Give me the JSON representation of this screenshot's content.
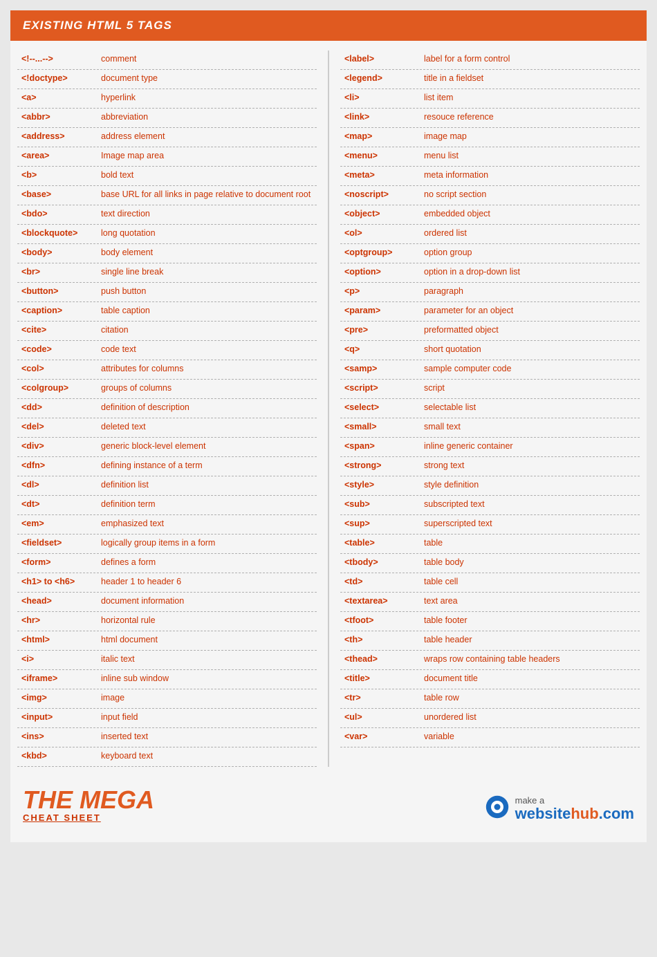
{
  "header": {
    "title": "EXISTING HTML 5 TAGS"
  },
  "footer": {
    "left_line1": "THE MEGA",
    "left_line2": "CHEAT SHEET",
    "right_line1": "make a",
    "right_line2": "websitehub.com"
  },
  "left_column": [
    {
      "tag": "&lt;!--...--&gt;",
      "desc": "comment"
    },
    {
      "tag": "&lt;!doctype&gt;",
      "desc": "document type"
    },
    {
      "tag": "&lt;a&gt;",
      "desc": "hyperlink"
    },
    {
      "tag": "&lt;abbr&gt;",
      "desc": "abbreviation"
    },
    {
      "tag": "&lt;address&gt;",
      "desc": "address element"
    },
    {
      "tag": "&lt;area&gt;",
      "desc": "Image map area"
    },
    {
      "tag": "&lt;b&gt;",
      "desc": "bold text"
    },
    {
      "tag": "&lt;base&gt;",
      "desc": "base URL for all links in page relative to document root"
    },
    {
      "tag": "&lt;bdo&gt;",
      "desc": "text direction"
    },
    {
      "tag": "&lt;blockquote&gt;",
      "desc": "long quotation"
    },
    {
      "tag": "&lt;body&gt;",
      "desc": "body element"
    },
    {
      "tag": "&lt;br&gt;",
      "desc": "single line break"
    },
    {
      "tag": "&lt;button&gt;",
      "desc": "push button"
    },
    {
      "tag": "&lt;caption&gt;",
      "desc": "table caption"
    },
    {
      "tag": "&lt;cite&gt;",
      "desc": "citation"
    },
    {
      "tag": "&lt;code&gt;",
      "desc": "code text"
    },
    {
      "tag": "&lt;col&gt;",
      "desc": "attributes for columns"
    },
    {
      "tag": "&lt;colgroup&gt;",
      "desc": "groups of columns"
    },
    {
      "tag": "&lt;dd&gt;",
      "desc": "definition of description"
    },
    {
      "tag": "&lt;del&gt;",
      "desc": "deleted text"
    },
    {
      "tag": "&lt;div&gt;",
      "desc": "generic block-level element"
    },
    {
      "tag": "&lt;dfn&gt;",
      "desc": "defining instance of a term"
    },
    {
      "tag": "&lt;dl&gt;",
      "desc": "definition list"
    },
    {
      "tag": "&lt;dt&gt;",
      "desc": "definition term"
    },
    {
      "tag": "&lt;em&gt;",
      "desc": "emphasized text"
    },
    {
      "tag": "&lt;fieldset&gt;",
      "desc": "logically group items in a form"
    },
    {
      "tag": "&lt;form&gt;",
      "desc": "defines a form"
    },
    {
      "tag": "&lt;h1&gt; to &lt;h6&gt;",
      "desc": "header 1 to header 6"
    },
    {
      "tag": "&lt;head&gt;",
      "desc": "document information"
    },
    {
      "tag": "&lt;hr&gt;",
      "desc": "horizontal rule"
    },
    {
      "tag": "&lt;html&gt;",
      "desc": "html document"
    },
    {
      "tag": "&lt;i&gt;",
      "desc": "italic text"
    },
    {
      "tag": "&lt;iframe&gt;",
      "desc": "inline sub window"
    },
    {
      "tag": "&lt;img&gt;",
      "desc": "image"
    },
    {
      "tag": "&lt;input&gt;",
      "desc": "input field"
    },
    {
      "tag": "&lt;ins&gt;",
      "desc": "inserted text"
    },
    {
      "tag": "&lt;kbd&gt;",
      "desc": "keyboard text"
    }
  ],
  "right_column": [
    {
      "tag": "&lt;label&gt;",
      "desc": "label for a form control"
    },
    {
      "tag": "&lt;legend&gt;",
      "desc": "title in a fieldset"
    },
    {
      "tag": "&lt;li&gt;",
      "desc": "list item"
    },
    {
      "tag": "&lt;link&gt;",
      "desc": "resouce reference"
    },
    {
      "tag": "&lt;map&gt;",
      "desc": "image map"
    },
    {
      "tag": "&lt;menu&gt;",
      "desc": "menu list"
    },
    {
      "tag": "&lt;meta&gt;",
      "desc": "meta information"
    },
    {
      "tag": "&lt;noscript&gt;",
      "desc": "no script section"
    },
    {
      "tag": "&lt;object&gt;",
      "desc": "embedded object"
    },
    {
      "tag": "&lt;ol&gt;",
      "desc": "ordered list"
    },
    {
      "tag": "&lt;optgroup&gt;",
      "desc": "option group"
    },
    {
      "tag": "&lt;option&gt;",
      "desc": "option in a drop-down list"
    },
    {
      "tag": "&lt;p&gt;",
      "desc": "paragraph"
    },
    {
      "tag": "&lt;param&gt;",
      "desc": "parameter for an object"
    },
    {
      "tag": "&lt;pre&gt;",
      "desc": "preformatted object"
    },
    {
      "tag": "&lt;q&gt;",
      "desc": "short quotation"
    },
    {
      "tag": "&lt;samp&gt;",
      "desc": "sample computer code"
    },
    {
      "tag": "&lt;script&gt;",
      "desc": "script"
    },
    {
      "tag": "&lt;select&gt;",
      "desc": "selectable list"
    },
    {
      "tag": "&lt;small&gt;",
      "desc": "small text"
    },
    {
      "tag": "&lt;span&gt;",
      "desc": "inline generic container"
    },
    {
      "tag": "&lt;strong&gt;",
      "desc": "strong text"
    },
    {
      "tag": "&lt;style&gt;",
      "desc": "style definition"
    },
    {
      "tag": "&lt;sub&gt;",
      "desc": "subscripted text"
    },
    {
      "tag": "&lt;sup&gt;",
      "desc": "superscripted text"
    },
    {
      "tag": "&lt;table&gt;",
      "desc": "table"
    },
    {
      "tag": "&lt;tbody&gt;",
      "desc": "table body"
    },
    {
      "tag": "&lt;td&gt;",
      "desc": "table cell"
    },
    {
      "tag": "&lt;textarea&gt;",
      "desc": "text area"
    },
    {
      "tag": "&lt;tfoot&gt;",
      "desc": "table footer"
    },
    {
      "tag": "&lt;th&gt;",
      "desc": "table header"
    },
    {
      "tag": "&lt;thead&gt;",
      "desc": "wraps row containing table headers"
    },
    {
      "tag": "&lt;title&gt;",
      "desc": "document title"
    },
    {
      "tag": "&lt;tr&gt;",
      "desc": "table row"
    },
    {
      "tag": "&lt;ul&gt;",
      "desc": "unordered list"
    },
    {
      "tag": "&lt;var&gt;",
      "desc": "variable"
    }
  ]
}
